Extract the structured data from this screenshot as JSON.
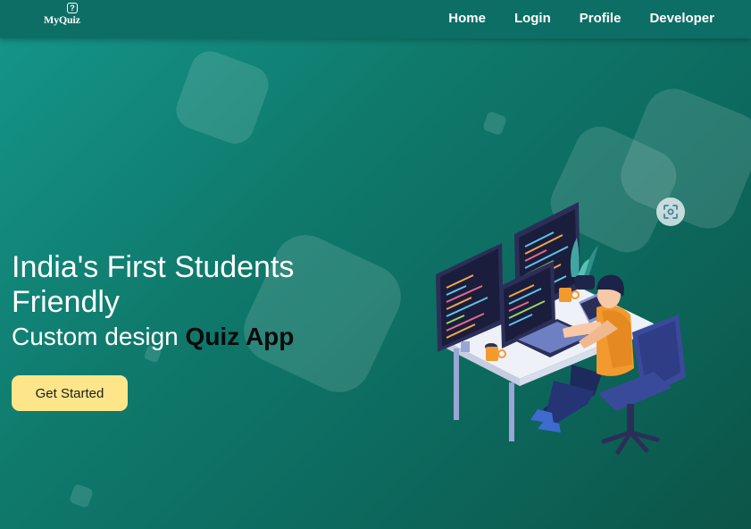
{
  "app": {
    "logo_text": "MyQuiz",
    "logo_badge": "?"
  },
  "nav": {
    "items": [
      {
        "label": "Home"
      },
      {
        "label": "Login"
      },
      {
        "label": "Profile"
      },
      {
        "label": "Developer"
      }
    ]
  },
  "hero": {
    "title": "India's First Students Friendly",
    "subtitle_prefix": "Custom design ",
    "subtitle_accent": "Quiz App",
    "cta_label": "Get Started"
  },
  "icons": {
    "logo": "quiz-logo-icon",
    "scan": "scan-focus-icon",
    "illustration": "developer-at-desk-illustration"
  },
  "colors": {
    "navbar": "#0d6e66",
    "background_start": "#15968b",
    "background_end": "#0c5548",
    "cta_background": "#fde58a",
    "accent_text": "#0b0b0b"
  }
}
